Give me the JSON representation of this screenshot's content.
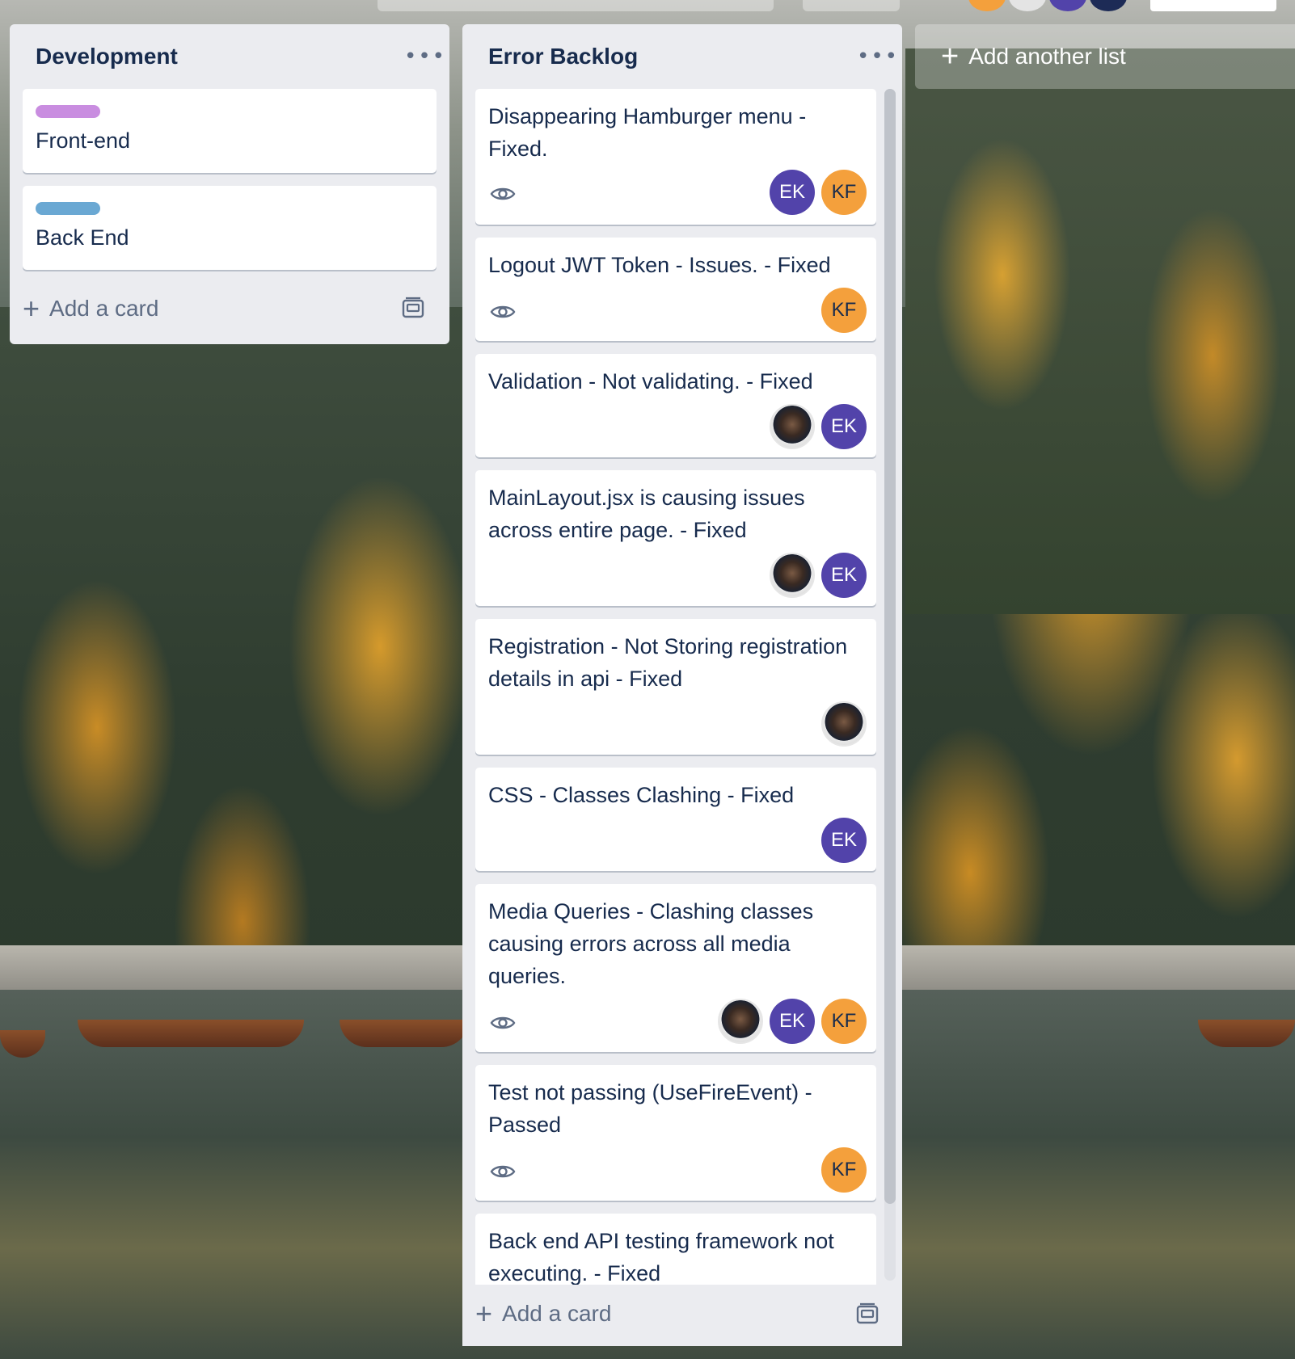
{
  "colors": {
    "list_bg": "#ebecf0",
    "label_front_end": "#c98de0",
    "label_back_end": "#6aa8d3",
    "member_ek": "#5243aa",
    "member_kf": "#f4a03c"
  },
  "lists": [
    {
      "title": "Development",
      "menu_icon": "more-horizontal-icon",
      "cards": [
        {
          "label_color": "#c98de0",
          "title": "Front-end"
        },
        {
          "label_color": "#6aa8d3",
          "title": "Back End"
        }
      ],
      "add_card": "Add a card"
    },
    {
      "title": "Error Backlog",
      "menu_icon": "more-horizontal-icon",
      "cards": [
        {
          "title": "Disappearing Hamburger menu - Fixed.",
          "watching": true,
          "members": [
            "EK",
            "KF"
          ]
        },
        {
          "title": "Logout JWT Token - Issues. - Fixed",
          "watching": true,
          "members": [
            "KF"
          ]
        },
        {
          "title": "Validation - Not validating. - Fixed",
          "watching": false,
          "members": [
            "photo",
            "EK"
          ]
        },
        {
          "title": "MainLayout.jsx is causing issues across entire page. - Fixed",
          "watching": false,
          "members": [
            "photo",
            "EK"
          ]
        },
        {
          "title": "Registration - Not Storing registration details in api - Fixed",
          "watching": false,
          "members": [
            "photo"
          ]
        },
        {
          "title": "CSS - Classes Clashing - Fixed",
          "watching": false,
          "members": [
            "EK"
          ]
        },
        {
          "title": "Media Queries - Clashing classes causing errors across all media queries.",
          "watching": true,
          "members": [
            "photo",
            "EK",
            "KF"
          ]
        },
        {
          "title": "Test not passing (UseFireEvent) - Passed",
          "watching": true,
          "members": [
            "KF"
          ]
        },
        {
          "title": "Back end API testing framework not executing. - Fixed"
        }
      ],
      "add_card": "Add a card"
    }
  ],
  "add_list": "Add another list",
  "members": {
    "ek": "EK",
    "kf": "KF"
  }
}
